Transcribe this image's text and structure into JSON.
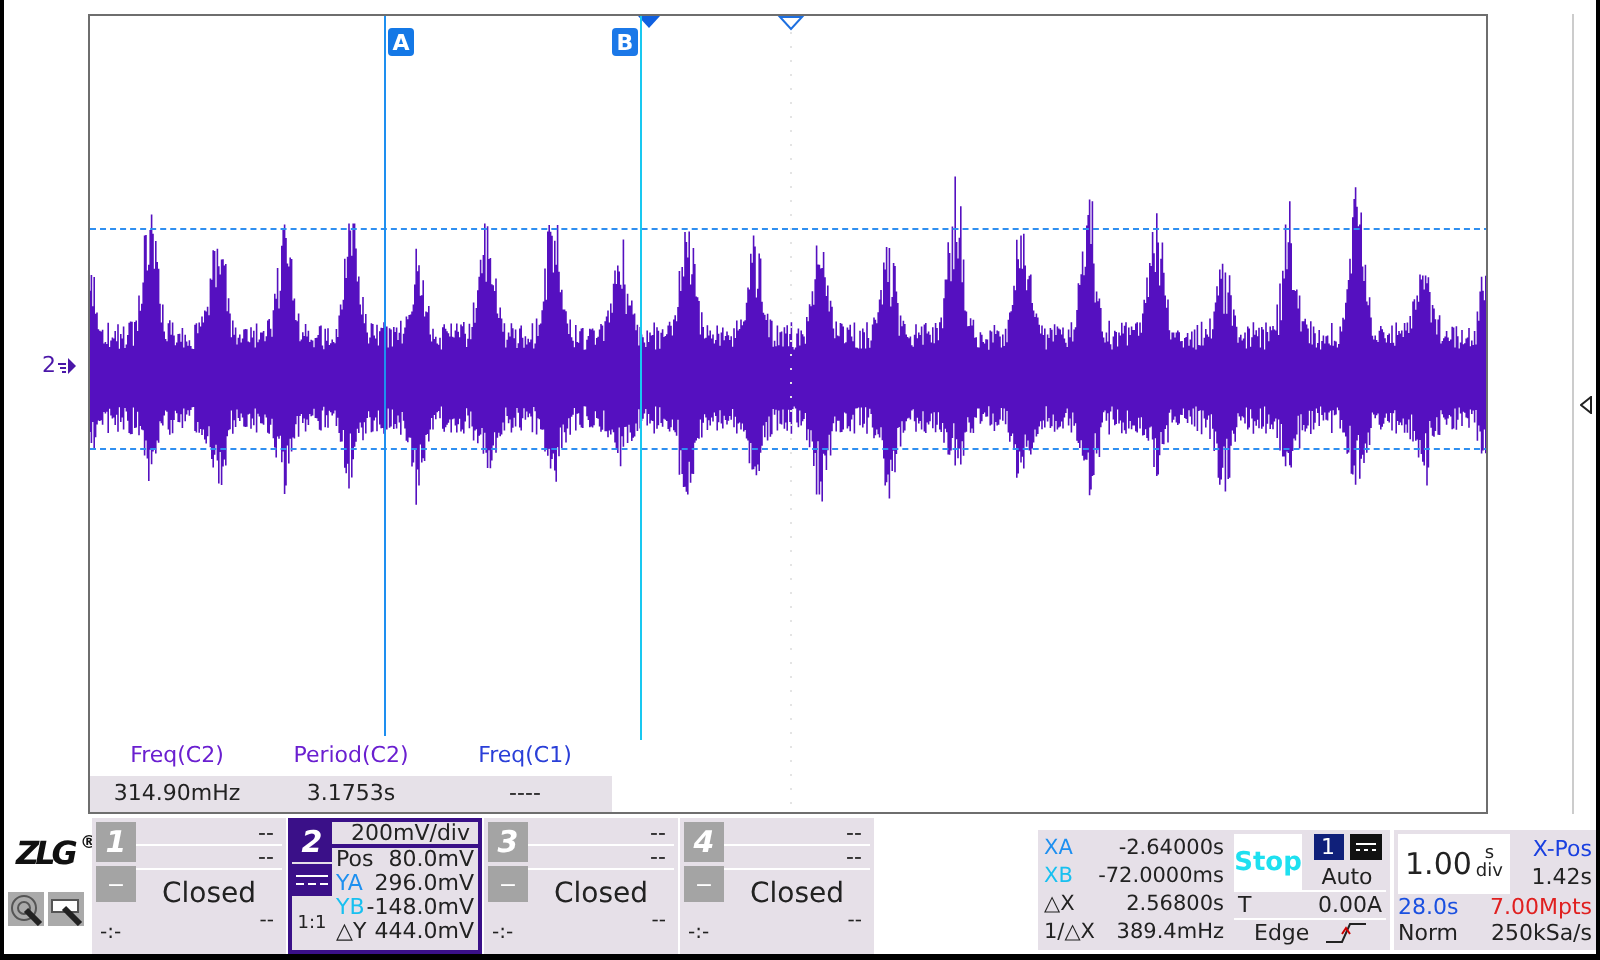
{
  "plot": {
    "channel_marker": "2",
    "cursors": [
      {
        "label": "A"
      },
      {
        "label": "B"
      }
    ],
    "measurements": [
      {
        "name": "Freq(C2)",
        "value": "314.90mHz",
        "color": "#6a1fd0"
      },
      {
        "name": "Period(C2)",
        "value": "3.1753s",
        "color": "#6a1fd0"
      },
      {
        "name": "Freq(C1)",
        "value": "----",
        "color": "#2a3fd8"
      }
    ]
  },
  "logo": {
    "text": "ZLG",
    "mark": "®"
  },
  "channels": [
    {
      "kind": "closed",
      "number": "1",
      "selected": false,
      "minus": "−",
      "rows": [
        "--",
        "--"
      ],
      "state": "Closed",
      "coupling": "-:-",
      "value": "--"
    },
    {
      "kind": "open",
      "number": "2",
      "selected": true,
      "scale": "200mV/div",
      "probe": "1:1",
      "rows": [
        {
          "label": "Pos",
          "value": "80.0mV"
        },
        {
          "label": "YA",
          "value": "296.0mV"
        },
        {
          "label": "YB",
          "value": "-148.0mV"
        },
        {
          "label": "△Y",
          "value": "444.0mV"
        }
      ]
    },
    {
      "kind": "closed",
      "number": "3",
      "selected": false,
      "minus": "−",
      "rows": [
        "--",
        "--"
      ],
      "state": "Closed",
      "coupling": "-:-",
      "value": "--"
    },
    {
      "kind": "closed",
      "number": "4",
      "selected": false,
      "minus": "−",
      "rows": [
        "--",
        "--"
      ],
      "state": "Closed",
      "coupling": "-:-",
      "value": "--"
    }
  ],
  "cursor_readout": [
    {
      "label": "XA",
      "value": "-2.64000s"
    },
    {
      "label": "XB",
      "value": "-72.0000ms"
    },
    {
      "label": "△X",
      "value": "2.56800s"
    },
    {
      "label": "1/△X",
      "value": "389.4mHz"
    }
  ],
  "trigger": {
    "run_state": "Stop",
    "source": "1",
    "mode": "Auto",
    "type_label": "T",
    "level": "0.00A",
    "type": "Edge"
  },
  "timebase": {
    "scale": "1.00",
    "unit_top": "s",
    "unit_bottom": "div",
    "xpos_label": "X-Pos",
    "xpos": "1.42s",
    "duration": "28.0s",
    "points": "7.00Mpts",
    "acq_mode": "Norm",
    "sample_rate": "250kSa/s"
  }
}
